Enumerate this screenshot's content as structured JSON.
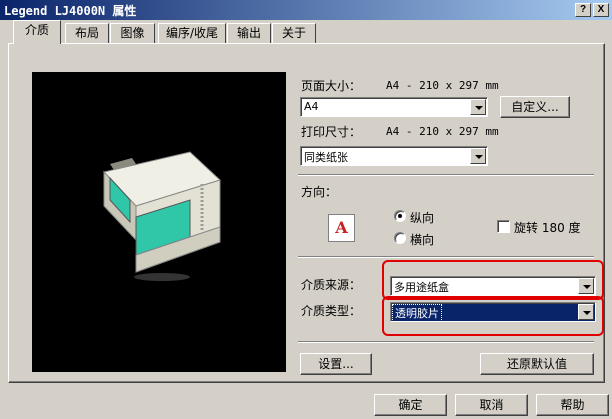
{
  "window": {
    "title": "Legend LJ4000N 属性",
    "help_btn": "?",
    "close_btn": "X"
  },
  "tabs": [
    {
      "label": "介质",
      "active": true
    },
    {
      "label": "布局"
    },
    {
      "label": "图像"
    },
    {
      "label": "编序/收尾"
    },
    {
      "label": "输出"
    },
    {
      "label": "关于"
    }
  ],
  "paper_size": {
    "label": "页面大小：",
    "value": "A4 - 210 x 297 mm",
    "selected": "A4",
    "custom_button": "自定义..."
  },
  "print_size": {
    "label": "打印尺寸：",
    "value": "A4 - 210 x 297 mm",
    "selected": "同类纸张"
  },
  "orientation": {
    "label": "方向：",
    "icon_letter": "A",
    "portrait": "纵向",
    "landscape": "横向",
    "rotate_label": "旋转 180 度"
  },
  "media_source": {
    "label": "介质来源：",
    "selected": "多用途纸盒"
  },
  "media_type": {
    "label": "介质类型：",
    "selected": "透明胶片"
  },
  "settings_button": "设置...",
  "restore_button": "还原默认值",
  "footer": {
    "ok": "确定",
    "cancel": "取消",
    "help": "帮助"
  },
  "colors": {
    "title_bar": "#0a246a",
    "highlight": "#e00000",
    "printer_panel": "#2fc7a8"
  }
}
